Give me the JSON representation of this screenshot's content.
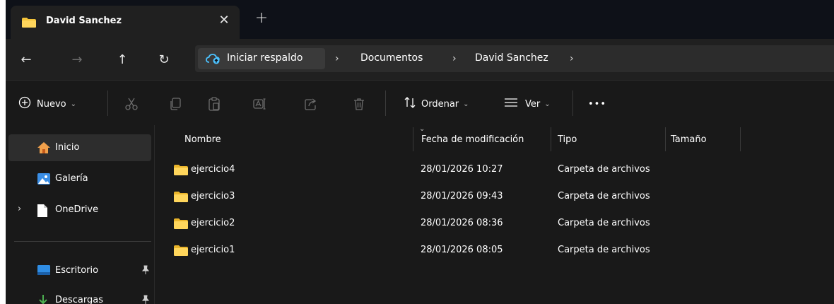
{
  "tab": {
    "title": "David Sanchez",
    "close": "✕",
    "new_tab": "+"
  },
  "nav": {
    "back": "←",
    "forward": "→",
    "up": "↑",
    "refresh": "↻"
  },
  "address": {
    "home_label": "Iniciar respaldo",
    "sep": "›",
    "crumbs": [
      "Documentos",
      "David Sanchez"
    ]
  },
  "commands": {
    "new_label": "Nuevo",
    "sort_label": "Ordenar",
    "view_label": "Ver",
    "more": "•••",
    "chevron": "⌄"
  },
  "sidebar": {
    "items": [
      {
        "label": "Inicio"
      },
      {
        "label": "Galería"
      },
      {
        "label": "OneDrive"
      },
      {
        "label": "Escritorio"
      },
      {
        "label": "Descargas"
      }
    ],
    "expand_glyph": "›",
    "pin_glyph": "📌"
  },
  "columns": {
    "name": "Nombre",
    "date": "Fecha de modificación",
    "type": "Tipo",
    "size": "Tamaño"
  },
  "files": [
    {
      "name": "ejercicio4",
      "date": "28/01/2026 10:27",
      "type": "Carpeta de archivos"
    },
    {
      "name": "ejercicio3",
      "date": "28/01/2026 09:43",
      "type": "Carpeta de archivos"
    },
    {
      "name": "ejercicio2",
      "date": "28/01/2026 08:36",
      "type": "Carpeta de archivos"
    },
    {
      "name": "ejercicio1",
      "date": "28/01/2026 08:05",
      "type": "Carpeta de archivos"
    }
  ],
  "colors": {
    "folder": "#f4c43a",
    "accent": "#4cc2ff",
    "background": "#191919"
  }
}
